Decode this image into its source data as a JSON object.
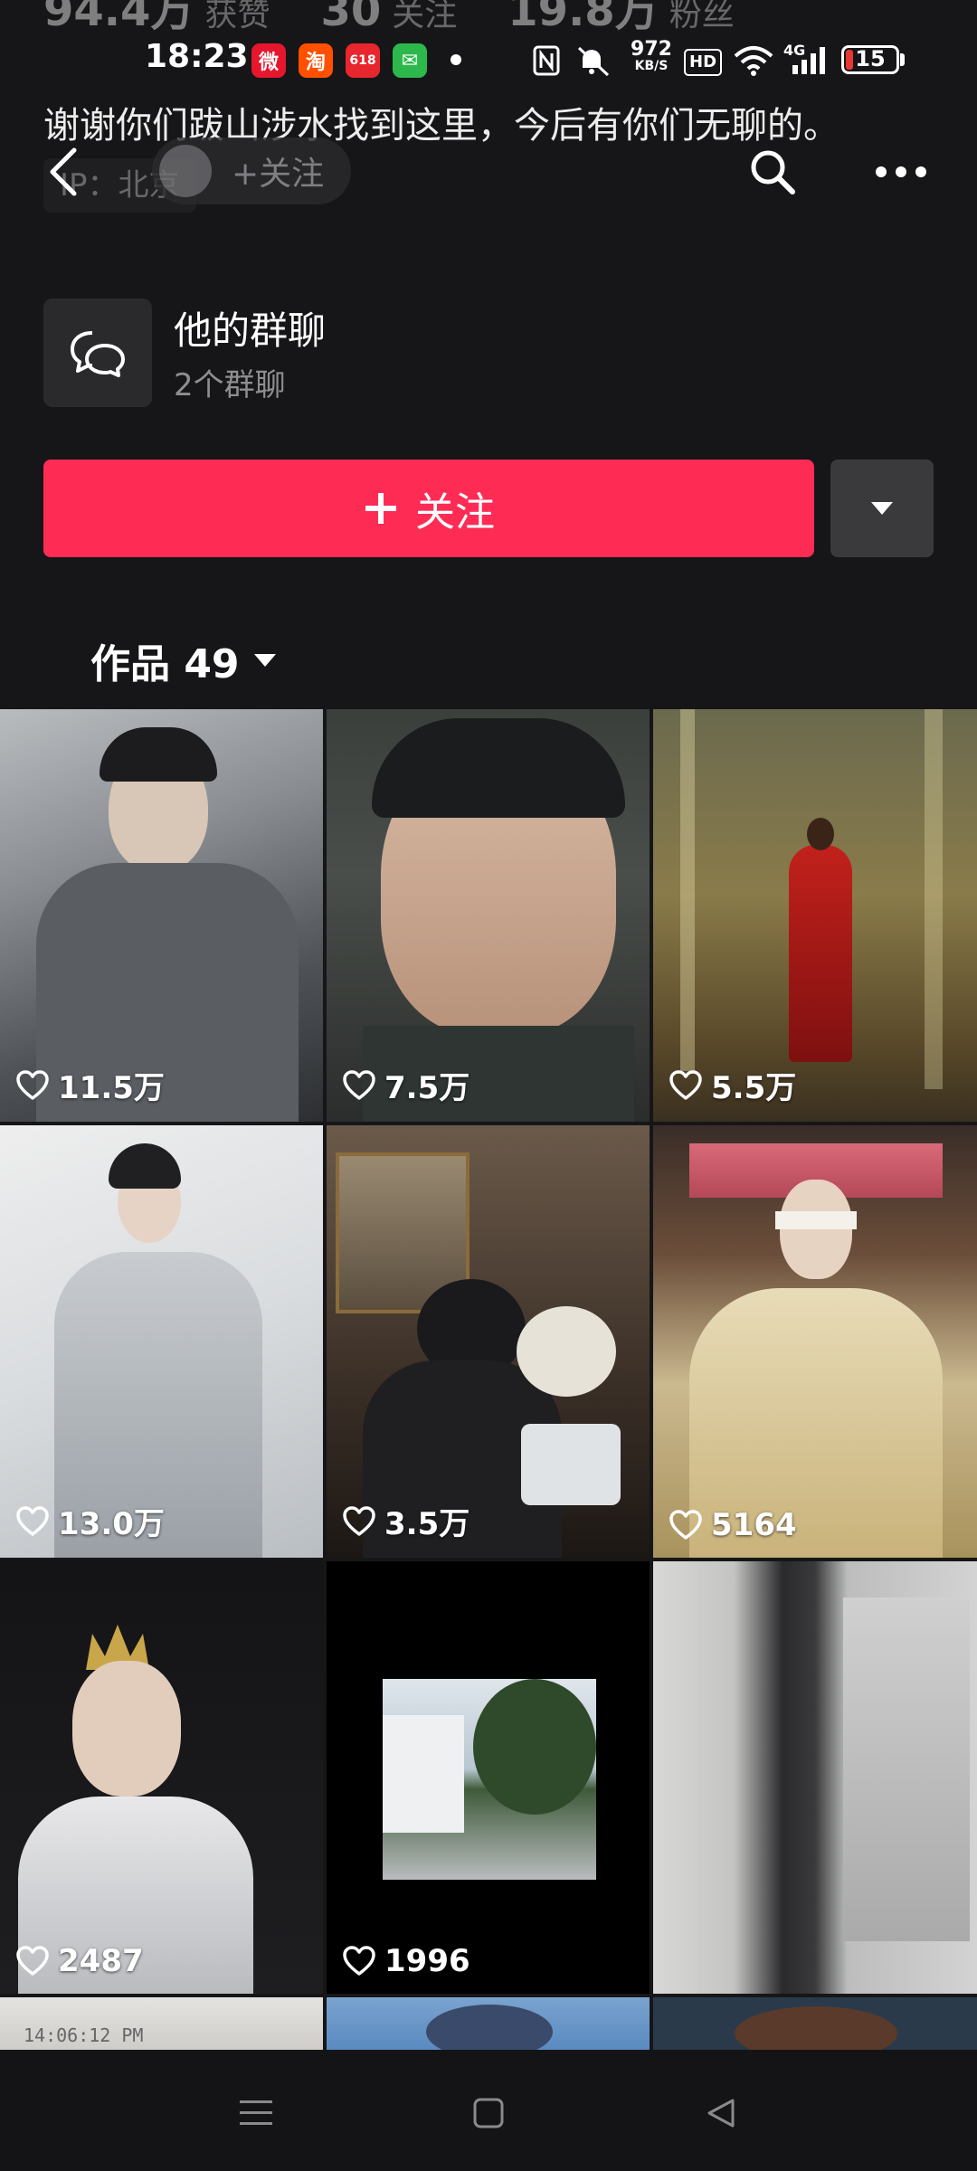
{
  "profile": {
    "stats": [
      {
        "num": "94.4万",
        "label": "获赞"
      },
      {
        "num": "30",
        "label": "关注"
      },
      {
        "num": "19.8万",
        "label": "粉丝"
      }
    ],
    "bio": "谢谢你们跋山涉水找到这里，今后有你们无聊的。",
    "ip": "IP：北京",
    "mini_follow_label": "+关注"
  },
  "status_bar": {
    "time": "18:23",
    "net_speed_value": "972",
    "net_speed_unit": "KB/S",
    "hd_label": "HD",
    "network": "4G",
    "battery": "15",
    "app_icons": [
      {
        "name": "weibo-icon",
        "glyph": "微",
        "color": "#e6162d"
      },
      {
        "name": "taobao-icon",
        "glyph": "淘",
        "color": "#ff5000"
      },
      {
        "name": "shopping-618-icon",
        "glyph": "618",
        "color": "#e8262d"
      },
      {
        "name": "messages-icon",
        "glyph": "✉",
        "color": "#2db84c"
      }
    ]
  },
  "group_chat": {
    "title": "他的群聊",
    "subtitle": "2个群聊"
  },
  "follow_button": {
    "label": "关注"
  },
  "works_tab": {
    "label": "作品 49"
  },
  "videos": [
    {
      "likes": "11.5万",
      "thumb": "portrait-gray-coat"
    },
    {
      "likes": "7.5万",
      "thumb": "closeup-portrait"
    },
    {
      "likes": "5.5万",
      "thumb": "red-robe-figure"
    },
    {
      "likes": "13.0万",
      "thumb": "white-hanfu"
    },
    {
      "likes": "3.5万",
      "thumb": "birthday-cake"
    },
    {
      "likes": "5164",
      "thumb": "blindfold-gold-robe"
    },
    {
      "likes": "2487",
      "thumb": "crown-portrait"
    },
    {
      "likes": "1996",
      "thumb": "tree-photo"
    },
    {
      "likes": "",
      "thumb": "doorway"
    }
  ],
  "partial_row": {
    "timestamp": "14:06:12 PM"
  },
  "colors": {
    "accent": "#fe2c55",
    "background": "#161618"
  }
}
